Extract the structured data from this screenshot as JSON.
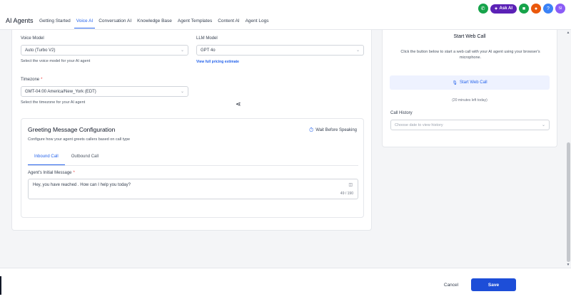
{
  "header": {
    "title": "AI Agents",
    "nav": [
      {
        "label": "Getting Started",
        "active": false
      },
      {
        "label": "Voice AI",
        "active": true
      },
      {
        "label": "Conversation AI",
        "active": false
      },
      {
        "label": "Knowledge Base",
        "active": false
      },
      {
        "label": "Agent Templates",
        "active": false
      },
      {
        "label": "Content AI",
        "active": false
      },
      {
        "label": "Agent Logs",
        "active": false
      }
    ],
    "ask_ai_label": "Ask AI",
    "avatar_initials": "SI"
  },
  "voice_model": {
    "label": "Voice Model",
    "value": "Auto (Turbo V2)",
    "helper": "Select the voice model for your AI agent"
  },
  "llm_model": {
    "label": "LLM Model",
    "value": "GPT 4o",
    "link": "View full pricing estimate"
  },
  "timezone": {
    "label": "Timezone",
    "required_mark": "*",
    "value": "GMT-04:00 America/New_York (EDT)",
    "helper": "Select the timezone for your AI agent"
  },
  "greeting": {
    "title": "Greeting Message Configuration",
    "subtitle": "Configure how your agent greets callers based on call type",
    "wait_label": "Wait Before Speaking",
    "tabs": [
      {
        "label": "Inbound Call",
        "active": true
      },
      {
        "label": "Outbound Call",
        "active": false
      }
    ],
    "message_label": "Agent's Initial Message",
    "message_required_mark": "*",
    "message_value": "Hey, you have reached . How can I help you today?",
    "counter": "49 / 190"
  },
  "web_call": {
    "title": "Start Web Call",
    "description": "Click the button below to start a web call with your AI agent using your browser's microphone.",
    "button_label": "Start Web Call",
    "minutes_left": "(20 minutes left today)",
    "history_label": "Call History",
    "history_placeholder": "Choose date to view history"
  },
  "footer": {
    "cancel_label": "Cancel",
    "save_label": "Save"
  },
  "colors": {
    "accent": "#2563eb",
    "save_button": "#1d4ed8",
    "ask_ai": "#5b21b6",
    "phone_icon": "#16a34a",
    "gift_icon": "#16a34a",
    "bell_icon": "#ea580c",
    "help_icon": "#3b82f6",
    "avatar": "#8b5cf6"
  }
}
